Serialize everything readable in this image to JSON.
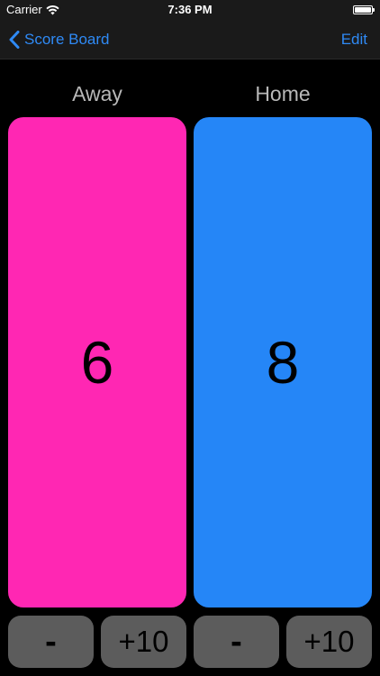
{
  "status_bar": {
    "carrier": "Carrier",
    "time": "7:36 PM"
  },
  "nav": {
    "back_label": "Score Board",
    "edit_label": "Edit",
    "accent_color": "#2f8af5"
  },
  "teams": [
    {
      "name": "Away",
      "score": "6",
      "color": "#ff27b3",
      "minus_label": "-",
      "plus_label": "+10"
    },
    {
      "name": "Home",
      "score": "8",
      "color": "#2586f7",
      "minus_label": "-",
      "plus_label": "+10"
    }
  ],
  "icons": {
    "wifi": "wifi-icon",
    "battery": "battery-icon",
    "back": "chevron-left-icon"
  }
}
